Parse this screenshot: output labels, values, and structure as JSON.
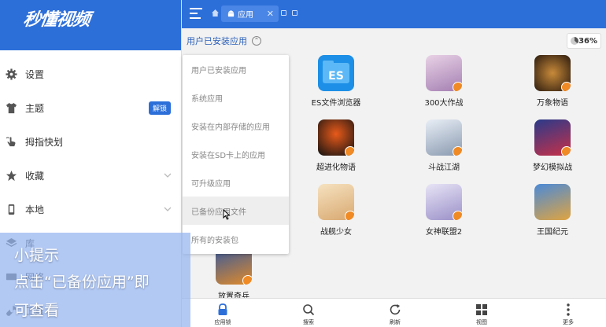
{
  "logo": {
    "text": "秒懂视频"
  },
  "sidebar": {
    "items": [
      {
        "label": "设置",
        "icon": "gear-icon"
      },
      {
        "label": "主题",
        "icon": "shirt-icon",
        "badge": "解锁"
      },
      {
        "label": "拇指快划",
        "icon": "hand-swipe-icon"
      },
      {
        "label": "收藏",
        "icon": "star-icon"
      },
      {
        "label": "本地",
        "icon": "phone-icon"
      },
      {
        "label": "库",
        "icon": "layers-icon"
      },
      {
        "label": "网络",
        "icon": "network-icon"
      },
      {
        "label": "工具",
        "icon": "wrench-icon"
      }
    ]
  },
  "topbar": {
    "tab_label": "应用",
    "close_glyph": "✕"
  },
  "filter": {
    "label": "用户已安装应用",
    "chevron": "⌃"
  },
  "storage": {
    "percent_text": "36%",
    "percent": 36
  },
  "dropdown": {
    "items": [
      "用户已安装应用",
      "系统应用",
      "安装在内部存储的应用",
      "安装在SD卡上的应用",
      "可升级应用",
      "已备份应用文件",
      "所有的安装包"
    ],
    "active_index": 5
  },
  "apps": [
    {
      "name": "ES文件浏览器",
      "color": "#1d8fe6"
    },
    {
      "name": "300大作战",
      "color": "#c9a6c8"
    },
    {
      "name": "万象物语",
      "color": "#3a2a1a"
    },
    {
      "name": "超进化物语",
      "color": "#1a1a1a"
    },
    {
      "name": "斗战江湖",
      "color": "#cfd6e0"
    },
    {
      "name": "梦幻模拟战",
      "color": "#b0283a"
    },
    {
      "name": "战舰少女",
      "color": "#e8c99a"
    },
    {
      "name": "女神联盟2",
      "color": "#c9c4e4"
    },
    {
      "name": "王国纪元",
      "color": "#d8a64a"
    },
    {
      "name": "放置奇兵",
      "color": "#5a6a8a"
    }
  ],
  "bottombar": {
    "items": [
      {
        "label": "应用锁",
        "icon": "lock-icon"
      },
      {
        "label": "搜索",
        "icon": "search-icon"
      },
      {
        "label": "刷新",
        "icon": "refresh-icon"
      },
      {
        "label": "视图",
        "icon": "grid-icon"
      },
      {
        "label": "更多",
        "icon": "more-icon"
      }
    ]
  },
  "caption": {
    "line1": "小提示",
    "line2": "点击“已备份应用”即",
    "line3": "可查看"
  },
  "colors": {
    "brand_blue": "#2d6fd9",
    "badge_orange": "#f08a24"
  }
}
